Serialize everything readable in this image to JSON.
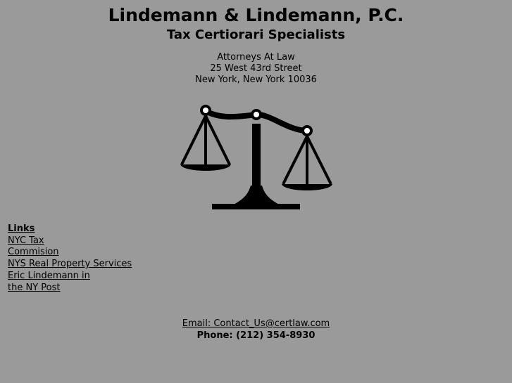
{
  "header": {
    "firm_name": "Lindemann & Lindemann, P.C.",
    "tagline": "Tax Certiorari Specialists"
  },
  "address": {
    "line1": "Attorneys At Law",
    "line2": "25 West 43rd Street",
    "line3": "New York, New York 10036"
  },
  "logo": {
    "icon": "scales-of-justice-icon"
  },
  "links": {
    "heading": "Links",
    "items": [
      {
        "line1": "NYC Tax",
        "line2": "Commision"
      },
      {
        "line1": "NYS Real Property Services",
        "line2": ""
      },
      {
        "line1": "Eric Lindemann in",
        "line2": "the NY Post"
      }
    ]
  },
  "contact": {
    "email_label": "Email: Contact_Us@certlaw.com",
    "phone": "Phone: (212) 354-8930"
  },
  "colors": {
    "background": "#9a9a9a",
    "text": "#000000"
  }
}
